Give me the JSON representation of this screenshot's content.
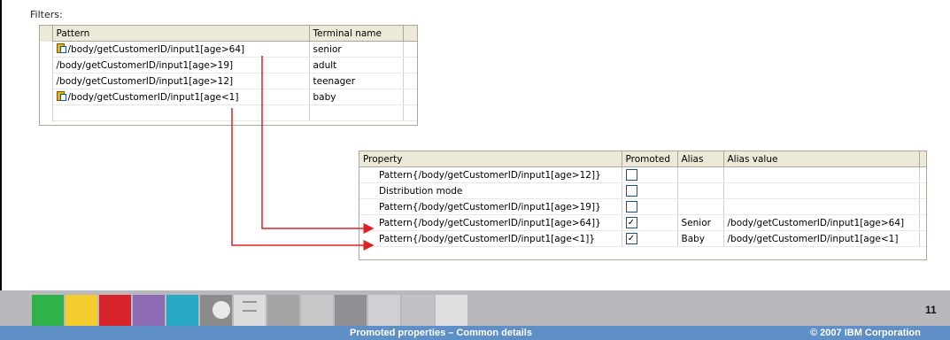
{
  "filters": {
    "label": "Filters:",
    "columns": [
      "Pattern",
      "Terminal name"
    ],
    "rows": [
      {
        "pattern": "/body/getCustomerID/input1[age>64]",
        "terminal": "senior",
        "icon": "promoted-pattern-icon"
      },
      {
        "pattern": "/body/getCustomerID/input1[age>19]",
        "terminal": "adult",
        "icon": ""
      },
      {
        "pattern": "/body/getCustomerID/input1[age>12]",
        "terminal": "teenager",
        "icon": ""
      },
      {
        "pattern": "/body/getCustomerID/input1[age<1]",
        "terminal": "baby",
        "icon": "promoted-pattern-icon"
      }
    ]
  },
  "properties": {
    "columns": [
      "Property",
      "Promoted",
      "Alias",
      "Alias value"
    ],
    "rows": [
      {
        "property": "Pattern{/body/getCustomerID/input1[age>12]}",
        "promoted": false,
        "alias": "",
        "alias_value": ""
      },
      {
        "property": "Distribution mode",
        "promoted": false,
        "alias": "",
        "alias_value": ""
      },
      {
        "property": "Pattern{/body/getCustomerID/input1[age>19]}",
        "promoted": false,
        "alias": "",
        "alias_value": ""
      },
      {
        "property": "Pattern{/body/getCustomerID/input1[age>64]}",
        "promoted": true,
        "alias": "Senior",
        "alias_value": "/body/getCustomerID/input1[age>64]"
      },
      {
        "property": "Pattern{/body/getCustomerID/input1[age<1]}",
        "promoted": true,
        "alias": "Baby",
        "alias_value": "/body/getCustomerID/input1[age<1]"
      }
    ]
  },
  "footer": {
    "title": "Promoted properties – Common details",
    "copyright": "© 2007 IBM Corporation",
    "page_number": "11"
  },
  "colors": {
    "arrow": "#e02020",
    "footer_bar": "#5f8fc7",
    "banner_gray": "#b9b9bd",
    "tiles": [
      "#2fb24a",
      "#f3cd2d",
      "#d8232a",
      "#8d6bb3",
      "#27a8c4",
      "#8c8c8c",
      "#dcdcdc",
      "#a5a5a5"
    ]
  }
}
